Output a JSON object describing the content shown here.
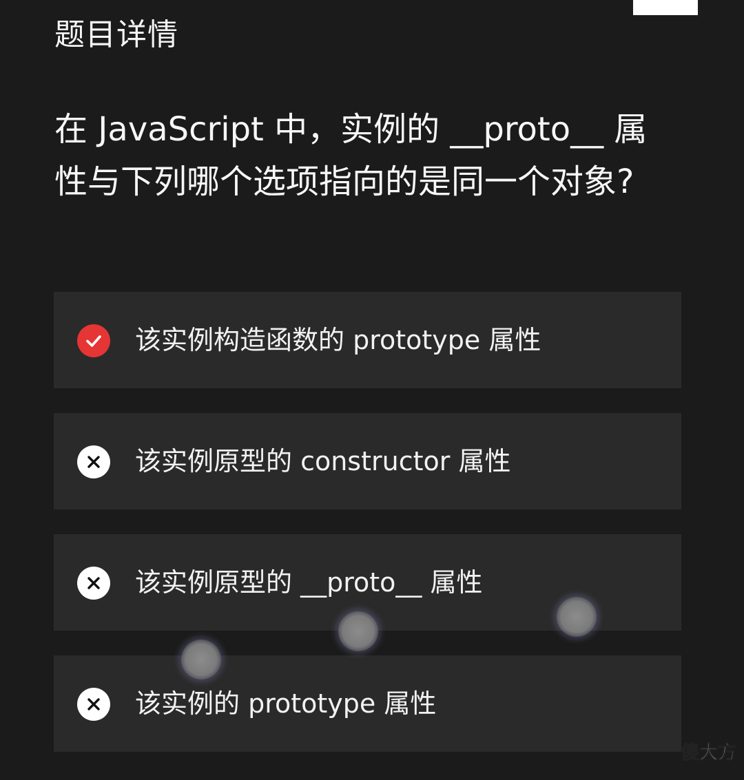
{
  "page": {
    "title": "题目详情",
    "question": "在 JavaScript 中，实例的 __proto__ 属性与下列哪个选项指向的是同一个对象?"
  },
  "options": [
    {
      "text": "该实例构造函数的 prototype 属性",
      "status": "correct",
      "icon": "check-icon"
    },
    {
      "text": "该实例原型的 constructor 属性",
      "status": "wrong",
      "icon": "cross-icon"
    },
    {
      "text": "该实例原型的 __proto__ 属性",
      "status": "wrong",
      "icon": "cross-icon"
    },
    {
      "text": "该实例的 prototype 属性",
      "status": "wrong",
      "icon": "cross-icon"
    }
  ],
  "colors": {
    "background": "#1b1b1b",
    "option_background": "#2a2a2a",
    "correct": "#e53535",
    "wrong": "#ffffff"
  },
  "watermark": {
    "first_char": "傻",
    "rest": "大方"
  }
}
